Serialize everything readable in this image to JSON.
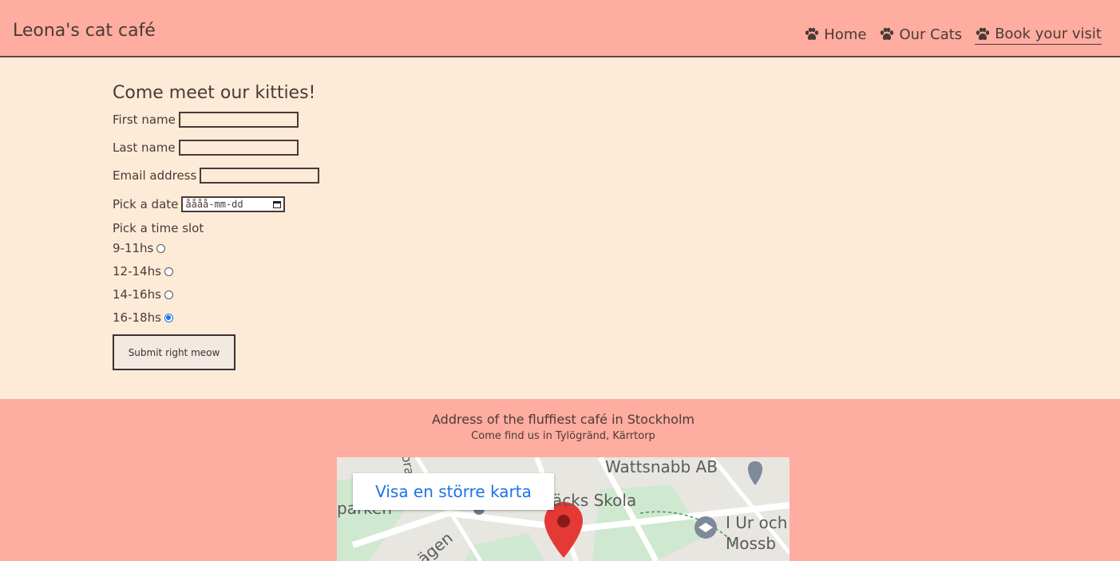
{
  "header": {
    "brand": "Leona's cat café",
    "nav": [
      {
        "label": "Home",
        "icon": "paw-icon"
      },
      {
        "label": "Our Cats",
        "icon": "paw-icon"
      },
      {
        "label": "Book your visit",
        "icon": "paw-icon",
        "active": true
      }
    ]
  },
  "form": {
    "title": "Come meet our kitties!",
    "first_name_label": "First name",
    "last_name_label": "Last name",
    "email_label": "Email address",
    "date_label": "Pick a date",
    "date_placeholder": "åååå-mm-dd",
    "time_label": "Pick a time slot",
    "slots": [
      {
        "label": "9-11hs",
        "checked": false
      },
      {
        "label": "12-14hs",
        "checked": false
      },
      {
        "label": "14-16hs",
        "checked": false
      },
      {
        "label": "16-18hs",
        "checked": true
      }
    ],
    "submit_label": "Submit right meow"
  },
  "footer": {
    "title": "Address of the fluffiest café in Stockholm",
    "subtitle": "Come find us in Tylögränd, Kärrtorp",
    "map": {
      "link_label": "Visa en större karta",
      "labels": [
        "Wattsnabb AB",
        "äcks Skola",
        "I Ur och",
        "Mossb",
        "ägen",
        "ora",
        "parken"
      ]
    }
  },
  "colors": {
    "header_bg": "#ffada0",
    "page_bg": "#fdebd8",
    "text": "#4a3a36",
    "radio_accent": "#1a73e8",
    "map_pin": "#e53935"
  }
}
